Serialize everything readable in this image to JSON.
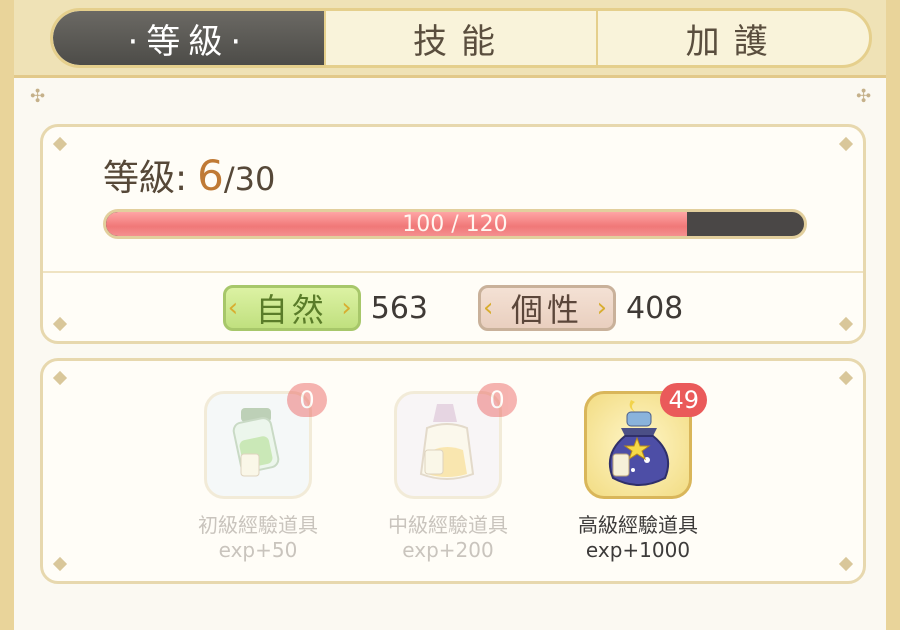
{
  "tabs": [
    {
      "label": "·等級·",
      "active": true
    },
    {
      "label": "技能",
      "active": false
    },
    {
      "label": "加護",
      "active": false
    }
  ],
  "level": {
    "label": "等級:",
    "current": "6",
    "max": "/30",
    "exp_text": "100 / 120",
    "exp_fraction": 0.833
  },
  "stats": {
    "nature": {
      "label": "自然",
      "value": "563",
      "color": "#c0e07f"
    },
    "personality": {
      "label": "個性",
      "value": "408",
      "color": "#e9cfbf"
    }
  },
  "items": [
    {
      "name": "初級經驗道具",
      "exp": "exp+50",
      "count": "0",
      "icon": "green-potion-icon",
      "enabled": false
    },
    {
      "name": "中級經驗道具",
      "exp": "exp+200",
      "count": "0",
      "icon": "yellow-potion-icon",
      "enabled": false
    },
    {
      "name": "高級經驗道具",
      "exp": "exp+1000",
      "count": "49",
      "icon": "purple-potion-icon",
      "enabled": true
    }
  ],
  "colors": {
    "progress_fill": "#f07878",
    "badge_count": "#ea5a5a",
    "level_accent": "#c07a35"
  }
}
